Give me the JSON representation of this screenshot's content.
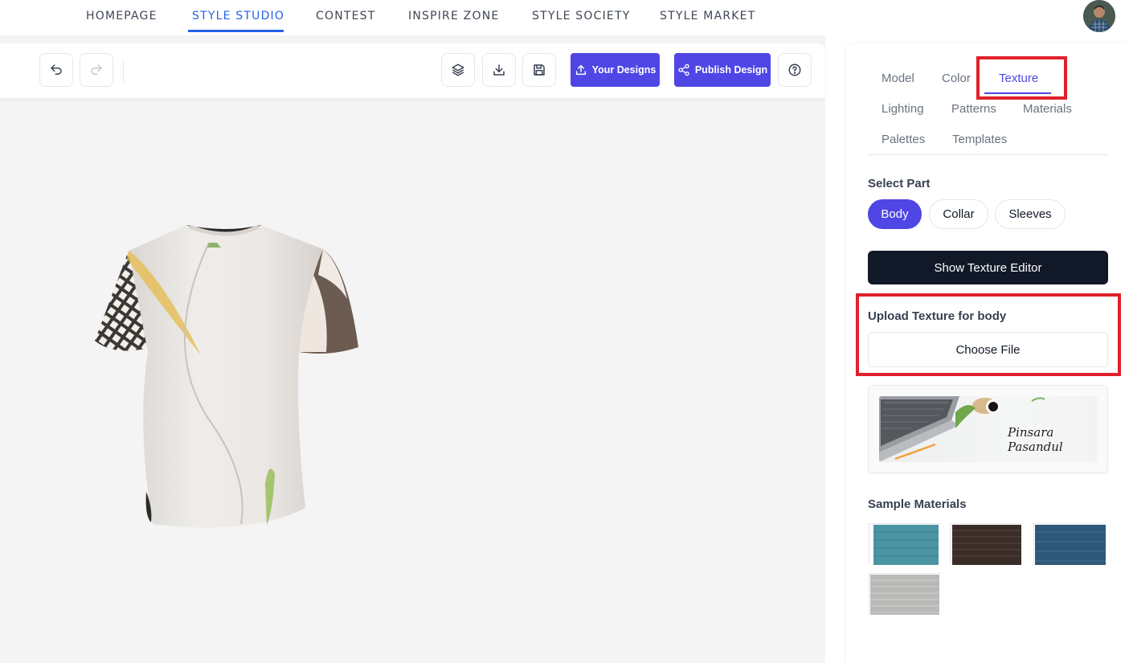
{
  "nav": {
    "items": [
      "HOMEPAGE",
      "STYLE STUDIO",
      "CONTEST",
      "INSPIRE ZONE",
      "STYLE SOCIETY",
      "STYLE MARKET"
    ],
    "active": "STYLE STUDIO"
  },
  "toolbar": {
    "your_designs_label": "Your Designs",
    "publish_label": "Publish Design"
  },
  "panel": {
    "tabs": [
      "Model",
      "Color",
      "Texture",
      "Lighting",
      "Patterns",
      "Materials",
      "Palettes",
      "Templates"
    ],
    "active_tab": "Texture",
    "select_part_label": "Select Part",
    "parts": [
      "Body",
      "Collar",
      "Sleeves"
    ],
    "active_part": "Body",
    "show_editor_label": "Show Texture Editor",
    "upload_label": "Upload Texture for body",
    "choose_file_label": "Choose File",
    "preview_signature": "Pinsara Pasandul",
    "sample_materials_label": "Sample Materials"
  },
  "colors": {
    "accent": "#4f46e5",
    "nav_active": "#2563eb",
    "highlight": "#e0212b",
    "dark_button": "#111827"
  },
  "swatches": [
    "teal-fabric",
    "dark-brown-fabric",
    "denim-blue-fabric",
    "light-grey-fabric"
  ]
}
